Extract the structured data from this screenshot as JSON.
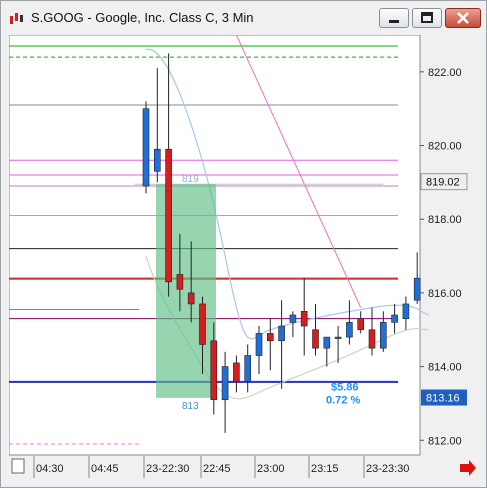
{
  "window": {
    "title": "S.GOOG - Google, Inc. Class C, 3 Min",
    "buttons": {
      "minimize": "minimize-icon",
      "maximize": "maximize-icon",
      "close": "close-icon"
    }
  },
  "price_axis": {
    "labels": [
      "822.00",
      "820.00",
      "818.00",
      "816.00",
      "814.00",
      "812.00"
    ],
    "last_price": "819.02",
    "current_marker": "813.16"
  },
  "time_axis": {
    "labels": [
      "04:30",
      "04:45",
      "23-22:30",
      "22:45",
      "23:00",
      "23:15",
      "23-23:30"
    ]
  },
  "annotations": {
    "zone_top_label": "819",
    "zone_bottom_label": "813",
    "change_value": "$5.86",
    "change_percent": "0.72 %"
  },
  "colors": {
    "bull": "#1e6fd9",
    "bear": "#d31f1f",
    "zone": "#5fbf86",
    "envelope": "#a8c8e8",
    "trendline": "#f06fc0",
    "accent_blue": "#1e90ff"
  },
  "chart_data": {
    "type": "candlestick",
    "title": "S.GOOG - Google, Inc. Class C, 3 Min",
    "ylim": [
      811.6,
      823.0
    ],
    "candles": [
      {
        "t": "22:24",
        "o": 818.9,
        "h": 821.2,
        "l": 818.7,
        "c": 821.0
      },
      {
        "t": "22:27",
        "o": 819.3,
        "h": 822.1,
        "l": 819.0,
        "c": 819.9
      },
      {
        "t": "22:30",
        "o": 819.9,
        "h": 822.5,
        "l": 815.9,
        "c": 816.3
      },
      {
        "t": "22:33",
        "o": 816.5,
        "h": 817.6,
        "l": 815.5,
        "c": 816.1
      },
      {
        "t": "22:36",
        "o": 816.0,
        "h": 817.4,
        "l": 815.2,
        "c": 815.7
      },
      {
        "t": "22:39",
        "o": 815.7,
        "h": 815.9,
        "l": 813.8,
        "c": 814.6
      },
      {
        "t": "22:42",
        "o": 814.7,
        "h": 815.2,
        "l": 812.7,
        "c": 813.1
      },
      {
        "t": "22:45",
        "o": 813.1,
        "h": 814.4,
        "l": 812.2,
        "c": 814.0
      },
      {
        "t": "22:48",
        "o": 814.1,
        "h": 814.3,
        "l": 813.3,
        "c": 813.6
      },
      {
        "t": "22:51",
        "o": 813.6,
        "h": 814.6,
        "l": 813.3,
        "c": 814.3
      },
      {
        "t": "22:54",
        "o": 814.3,
        "h": 815.1,
        "l": 813.8,
        "c": 814.9
      },
      {
        "t": "22:57",
        "o": 814.9,
        "h": 815.3,
        "l": 813.9,
        "c": 814.7
      },
      {
        "t": "23:00",
        "o": 814.7,
        "h": 815.8,
        "l": 813.4,
        "c": 815.1
      },
      {
        "t": "23:03",
        "o": 815.2,
        "h": 815.5,
        "l": 814.8,
        "c": 815.4
      },
      {
        "t": "23:06",
        "o": 815.5,
        "h": 816.4,
        "l": 814.3,
        "c": 815.1
      },
      {
        "t": "23:09",
        "o": 815.0,
        "h": 815.7,
        "l": 814.3,
        "c": 814.5
      },
      {
        "t": "23:12",
        "o": 814.5,
        "h": 814.8,
        "l": 814.0,
        "c": 814.8
      },
      {
        "t": "23:15",
        "o": 814.8,
        "h": 815.1,
        "l": 814.1,
        "c": 814.8
      },
      {
        "t": "23:18",
        "o": 814.8,
        "h": 815.8,
        "l": 814.6,
        "c": 815.2
      },
      {
        "t": "23:21",
        "o": 815.3,
        "h": 815.5,
        "l": 814.9,
        "c": 815.0
      },
      {
        "t": "23:24",
        "o": 815.0,
        "h": 815.6,
        "l": 814.3,
        "c": 814.5
      },
      {
        "t": "23:27",
        "o": 814.5,
        "h": 815.5,
        "l": 814.4,
        "c": 815.2
      },
      {
        "t": "23:30",
        "o": 815.2,
        "h": 815.7,
        "l": 814.9,
        "c": 815.4
      },
      {
        "t": "23:33",
        "o": 815.3,
        "h": 815.9,
        "l": 815.0,
        "c": 815.7
      },
      {
        "t": "23:36",
        "o": 815.8,
        "h": 817.1,
        "l": 815.7,
        "c": 816.4
      }
    ],
    "horizontal_levels": [
      {
        "price": 822.7,
        "color": "#00b000",
        "style": "solid"
      },
      {
        "price": 822.4,
        "color": "#00b000",
        "style": "dashed"
      },
      {
        "price": 821.1,
        "color": "#888888",
        "style": "solid"
      },
      {
        "price": 819.6,
        "color": "#e060e0",
        "style": "solid"
      },
      {
        "price": 819.2,
        "color": "#e060e0",
        "style": "solid"
      },
      {
        "price": 818.9,
        "color": "#c080c0",
        "style": "solid"
      },
      {
        "price": 818.1,
        "color": "#e080e0",
        "style": "solid"
      },
      {
        "price": 817.2,
        "color": "#222222",
        "style": "solid"
      },
      {
        "price": 816.4,
        "color": "#c02020",
        "style": "solid"
      },
      {
        "price": 815.3,
        "color": "#800060",
        "style": "solid"
      },
      {
        "price": 813.6,
        "color": "#2020c0",
        "style": "solid"
      }
    ]
  }
}
